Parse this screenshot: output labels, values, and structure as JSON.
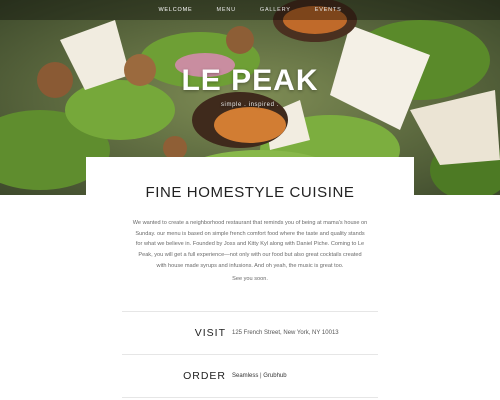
{
  "nav": {
    "items": [
      {
        "label": "WELCOME",
        "active": true
      },
      {
        "label": "MENU",
        "active": false
      },
      {
        "label": "GALLERY",
        "active": false
      },
      {
        "label": "EVENTS",
        "active": false
      }
    ]
  },
  "hero": {
    "brand": "LE PEAK",
    "tagline": "simple . inspired ."
  },
  "main": {
    "heading": "FINE HOMESTYLE CUISINE",
    "about_lines": [
      "We wanted to create a neighborhood restaurant that reminds you of being at mama's house on",
      "Sunday. our menu is based on simple french comfort food where the taste and quality stands",
      "for what we believe in. Founded by Joss and Kitty Kyl along with Daniel Piche. Coming to Le",
      "Peak, you will get a full experience—not only with our food but also great cocktails created",
      "with house made syrups and infusions. And oh yeah, the music is great too."
    ],
    "signoff": "See you soon."
  },
  "visit": {
    "label": "VISIT",
    "address": "125 French Street, New York, NY 10013"
  },
  "order": {
    "label": "ORDER",
    "link1": "Seamless",
    "separator": " | ",
    "link2": "Grubhub"
  },
  "colors": {
    "hero_green": "#6f7a52",
    "card_bg": "#ffffff",
    "text_dark": "#222222"
  }
}
